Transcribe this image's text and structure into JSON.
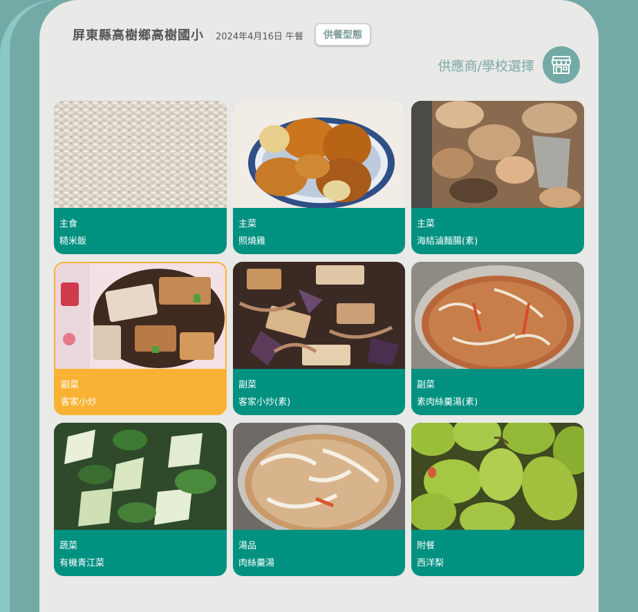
{
  "header": {
    "school_name": "屏東縣高樹鄉高樹國小",
    "meal_date": "2024年4月16日 午餐",
    "meal_type_button": "供餐型態",
    "vendor_label": "供應商/學校選擇",
    "vendor_icon": "store-icon"
  },
  "colors": {
    "accent": "#009181",
    "selected": "#f9b233",
    "frame": "#74aaa6"
  },
  "dishes": [
    {
      "category": "主食",
      "name": "糙米飯",
      "photo": "rice-photo",
      "selected": false
    },
    {
      "category": "主菜",
      "name": "照燒雞",
      "photo": "teriyaki-chicken-photo",
      "selected": false
    },
    {
      "category": "主菜",
      "name": "海結滷麵腸(素)",
      "photo": "braised-kelp-gluten-photo",
      "selected": false
    },
    {
      "category": "副菜",
      "name": "客家小炒",
      "photo": "hakka-stir-fry-photo",
      "selected": true
    },
    {
      "category": "副菜",
      "name": "客家小炒(素)",
      "photo": "vegetarian-hakka-stir-fry-photo",
      "selected": false
    },
    {
      "category": "副菜",
      "name": "素肉絲羹湯(素)",
      "photo": "vegetarian-thick-soup-photo",
      "selected": false
    },
    {
      "category": "蔬菜",
      "name": "有機青江菜",
      "photo": "bok-choy-photo",
      "selected": false
    },
    {
      "category": "湯品",
      "name": "肉絲羹湯",
      "photo": "pork-thick-soup-photo",
      "selected": false
    },
    {
      "category": "附餐",
      "name": "西洋梨",
      "photo": "pears-photo",
      "selected": false
    }
  ]
}
